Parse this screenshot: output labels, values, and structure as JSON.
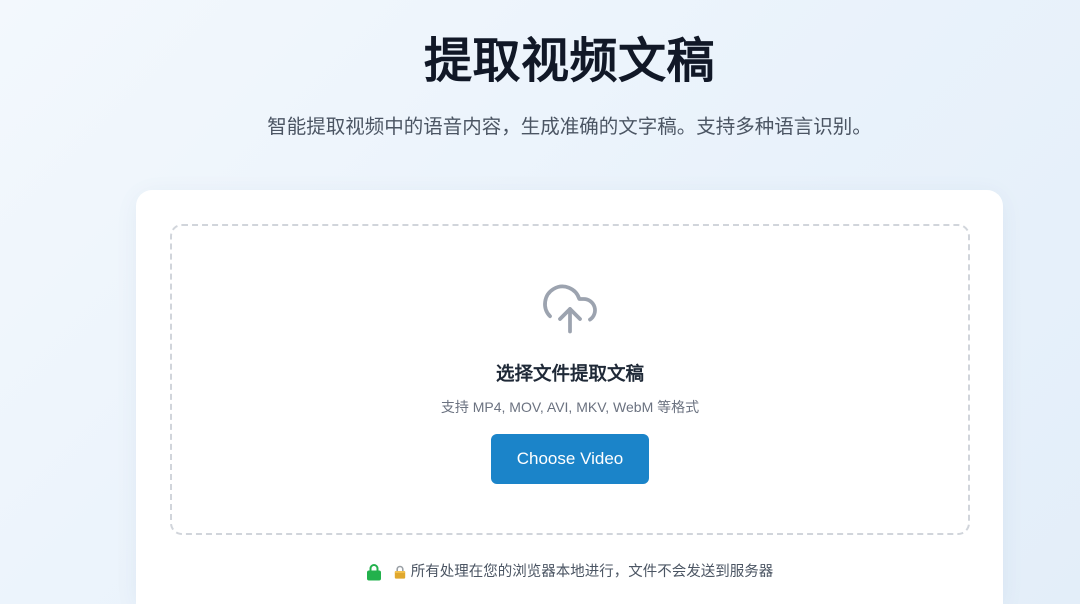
{
  "header": {
    "title": "提取视频文稿",
    "subtitle": "智能提取视频中的语音内容，生成准确的文字稿。支持多种语言识别。"
  },
  "upload": {
    "icon": "cloud-upload-icon",
    "heading": "选择文件提取文稿",
    "formats": "支持 MP4, MOV, AVI, MKV, WebM 等格式",
    "button_label": "Choose Video"
  },
  "privacy": {
    "icons": [
      "lock-icon",
      "lock-emoji-icon"
    ],
    "text": "所有处理在您的浏览器本地进行，文件不会发送到服务器"
  },
  "colors": {
    "background": "#ebf3fb",
    "card": "#ffffff",
    "accent": "#1b84c9",
    "lock": "#22b14c",
    "title": "#111827",
    "muted": "#6b7280",
    "dropzone_border": "#d1d5db"
  }
}
